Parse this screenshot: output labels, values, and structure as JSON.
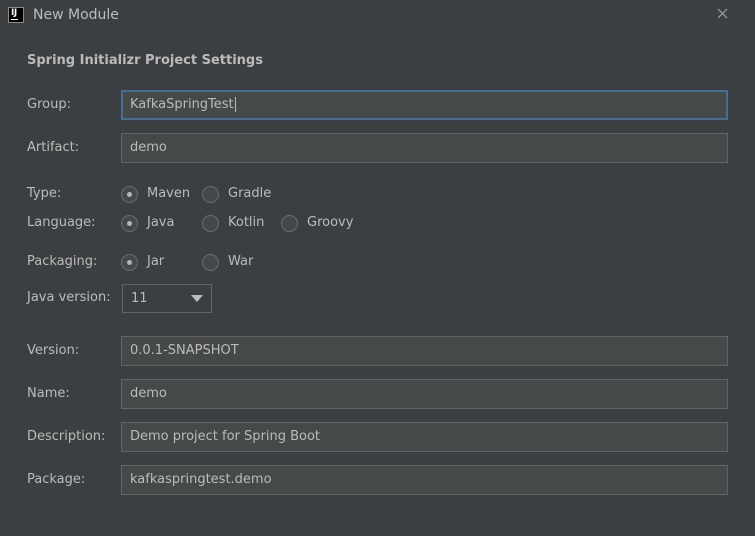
{
  "window": {
    "title": "New Module",
    "app_icon": "intellij-idea-icon",
    "close_icon": "close-icon"
  },
  "form": {
    "section_title": "Spring Initializr Project Settings",
    "group": {
      "label": "Group:",
      "value": "KafkaSpringTest"
    },
    "artifact": {
      "label": "Artifact:",
      "value": "demo"
    },
    "type": {
      "label": "Type:",
      "options": [
        {
          "label": "Maven",
          "selected": true
        },
        {
          "label": "Gradle",
          "selected": false
        }
      ]
    },
    "language": {
      "label": "Language:",
      "options": [
        {
          "label": "Java",
          "selected": true
        },
        {
          "label": "Kotlin",
          "selected": false
        },
        {
          "label": "Groovy",
          "selected": false
        }
      ]
    },
    "packaging": {
      "label": "Packaging:",
      "options": [
        {
          "label": "Jar",
          "selected": true
        },
        {
          "label": "War",
          "selected": false
        }
      ]
    },
    "java_version": {
      "label": "Java version:",
      "value": "11"
    },
    "version": {
      "label": "Version:",
      "value": "0.0.1-SNAPSHOT"
    },
    "name": {
      "label": "Name:",
      "value": "demo"
    },
    "description": {
      "label": "Description:",
      "value": "Demo project for Spring Boot"
    },
    "package": {
      "label": "Package:",
      "value": "kafkaspringtest.demo"
    }
  },
  "colors": {
    "background": "#3c3f41",
    "field_background": "#45494a",
    "field_border": "#646464",
    "focus_border": "#466d94",
    "text": "#bbbbbb"
  }
}
